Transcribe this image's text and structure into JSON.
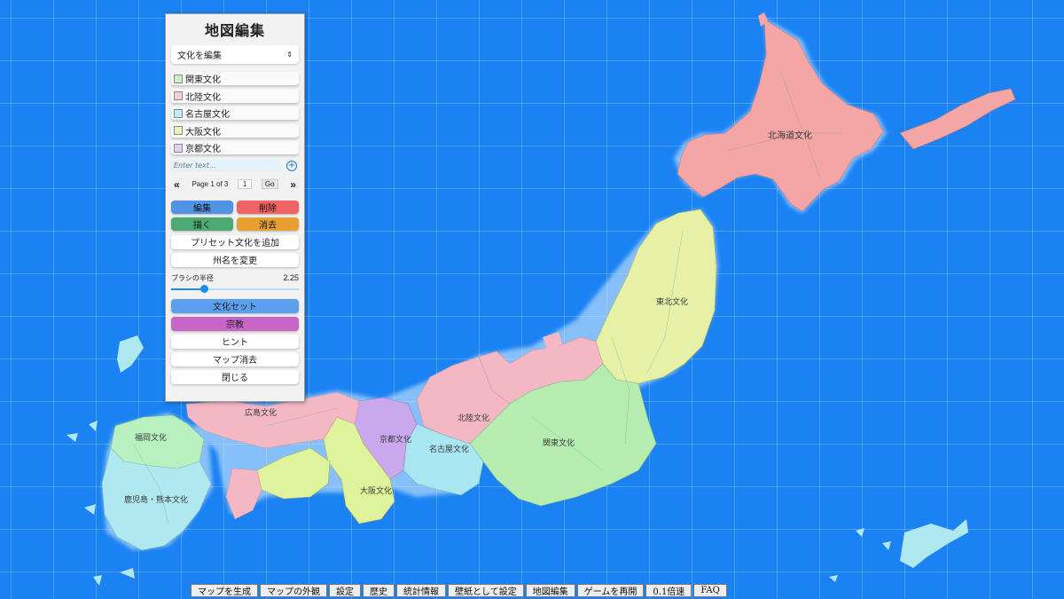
{
  "panel": {
    "title": "地図編集",
    "mode_select": "文化を編集",
    "cultures": [
      {
        "name": "関東文化",
        "color": "#c9f2c4"
      },
      {
        "name": "北陸文化",
        "color": "#f6cfd0"
      },
      {
        "name": "名古屋文化",
        "color": "#c4ecf6"
      },
      {
        "name": "大阪文化",
        "color": "#eaf6c0"
      },
      {
        "name": "京都文化",
        "color": "#e1d0f6"
      }
    ],
    "text_placeholder": "Enter text...",
    "pager": {
      "prev": "«",
      "label": "Page 1 of 3",
      "page": "1",
      "go": "Go",
      "next": "»"
    },
    "actions": {
      "edit": {
        "label": "編集",
        "color": "#4f94e4"
      },
      "delete": {
        "label": "削除",
        "color": "#f06464"
      },
      "draw": {
        "label": "描く",
        "color": "#4caa72"
      },
      "erase": {
        "label": "消去",
        "color": "#e8a030"
      }
    },
    "add_preset": "プリセット文化を追加",
    "rename_state": "州名を変更",
    "brush_label": "ブラシの半径",
    "brush_value": "2.25",
    "brush_fraction": 0.26,
    "culture_set": {
      "label": "文化セット",
      "color": "#5aa0ee"
    },
    "religion": {
      "label": "宗教",
      "color": "#c865c9"
    },
    "hint": "ヒント",
    "clear_map": "マップ消去",
    "close": "閉じる"
  },
  "map": {
    "ocean_color": "#1a82f2",
    "regions": [
      {
        "id": "hokkaido",
        "label": "北海道文化",
        "color": "#f4a5a5"
      },
      {
        "id": "tohoku",
        "label": "東北文化",
        "color": "#e6f1a7"
      },
      {
        "id": "hokuriku",
        "label": "北陸文化",
        "color": "#f4b8c4"
      },
      {
        "id": "kanto",
        "label": "関東文化",
        "color": "#b5ecb0"
      },
      {
        "id": "nagoya",
        "label": "名古屋文化",
        "color": "#a8e6f2"
      },
      {
        "id": "kyoto",
        "label": "京都文化",
        "color": "#caa8ee"
      },
      {
        "id": "osaka",
        "label": "大阪文化",
        "color": "#dff49a"
      },
      {
        "id": "hiroshima",
        "label": "広島文化",
        "color": "#f4b8c4"
      },
      {
        "id": "fukuoka",
        "label": "福岡文化",
        "color": "#b8f0c0"
      },
      {
        "id": "kagoshima",
        "label": "鹿児島・熊本文化",
        "color": "#b0e8f0"
      }
    ]
  },
  "bottombar": [
    "マップを生成",
    "マップの外観",
    "設定",
    "歴史",
    "統計情報",
    "壁紙として設定",
    "地図編集",
    "ゲームを再開",
    "0.1倍速",
    "FAQ"
  ]
}
